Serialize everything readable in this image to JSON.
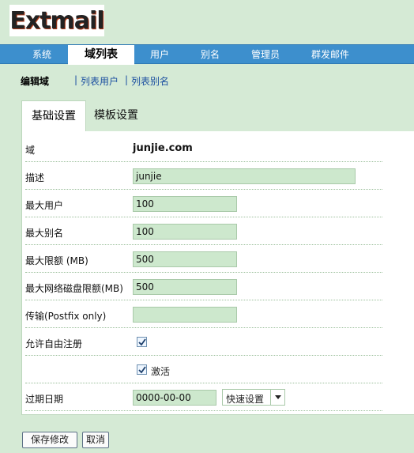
{
  "logo": {
    "text": "Extmail"
  },
  "nav": {
    "items": [
      "系统",
      "域列表",
      "用户",
      "别名",
      "管理员",
      "群发邮件"
    ],
    "active": "域列表"
  },
  "subnav": {
    "current": "编辑域",
    "links": [
      "列表用户",
      "列表别名"
    ]
  },
  "tabs": [
    "基础设置",
    "模板设置"
  ],
  "form": {
    "domain": {
      "label": "域",
      "value": "junjie.com"
    },
    "description": {
      "label": "描述",
      "value": "junjie"
    },
    "max_users": {
      "label": "最大用户",
      "value": "100"
    },
    "max_aliases": {
      "label": "最大别名",
      "value": "100"
    },
    "max_quota": {
      "label": "最大限额 (MB)",
      "value": "500"
    },
    "max_netdisk": {
      "label": "最大网络磁盘限额(MB)",
      "value": "500"
    },
    "transport": {
      "label": "传输(Postfix only)",
      "value": ""
    },
    "allow_signup": {
      "label": "允许自由注册",
      "checked": true
    },
    "active": {
      "label": "激活",
      "checked": true
    },
    "expire": {
      "label": "过期日期",
      "value": "0000-00-00",
      "select_value": "快速设置"
    }
  },
  "buttons": {
    "save": "保存修改",
    "cancel": "取消"
  }
}
